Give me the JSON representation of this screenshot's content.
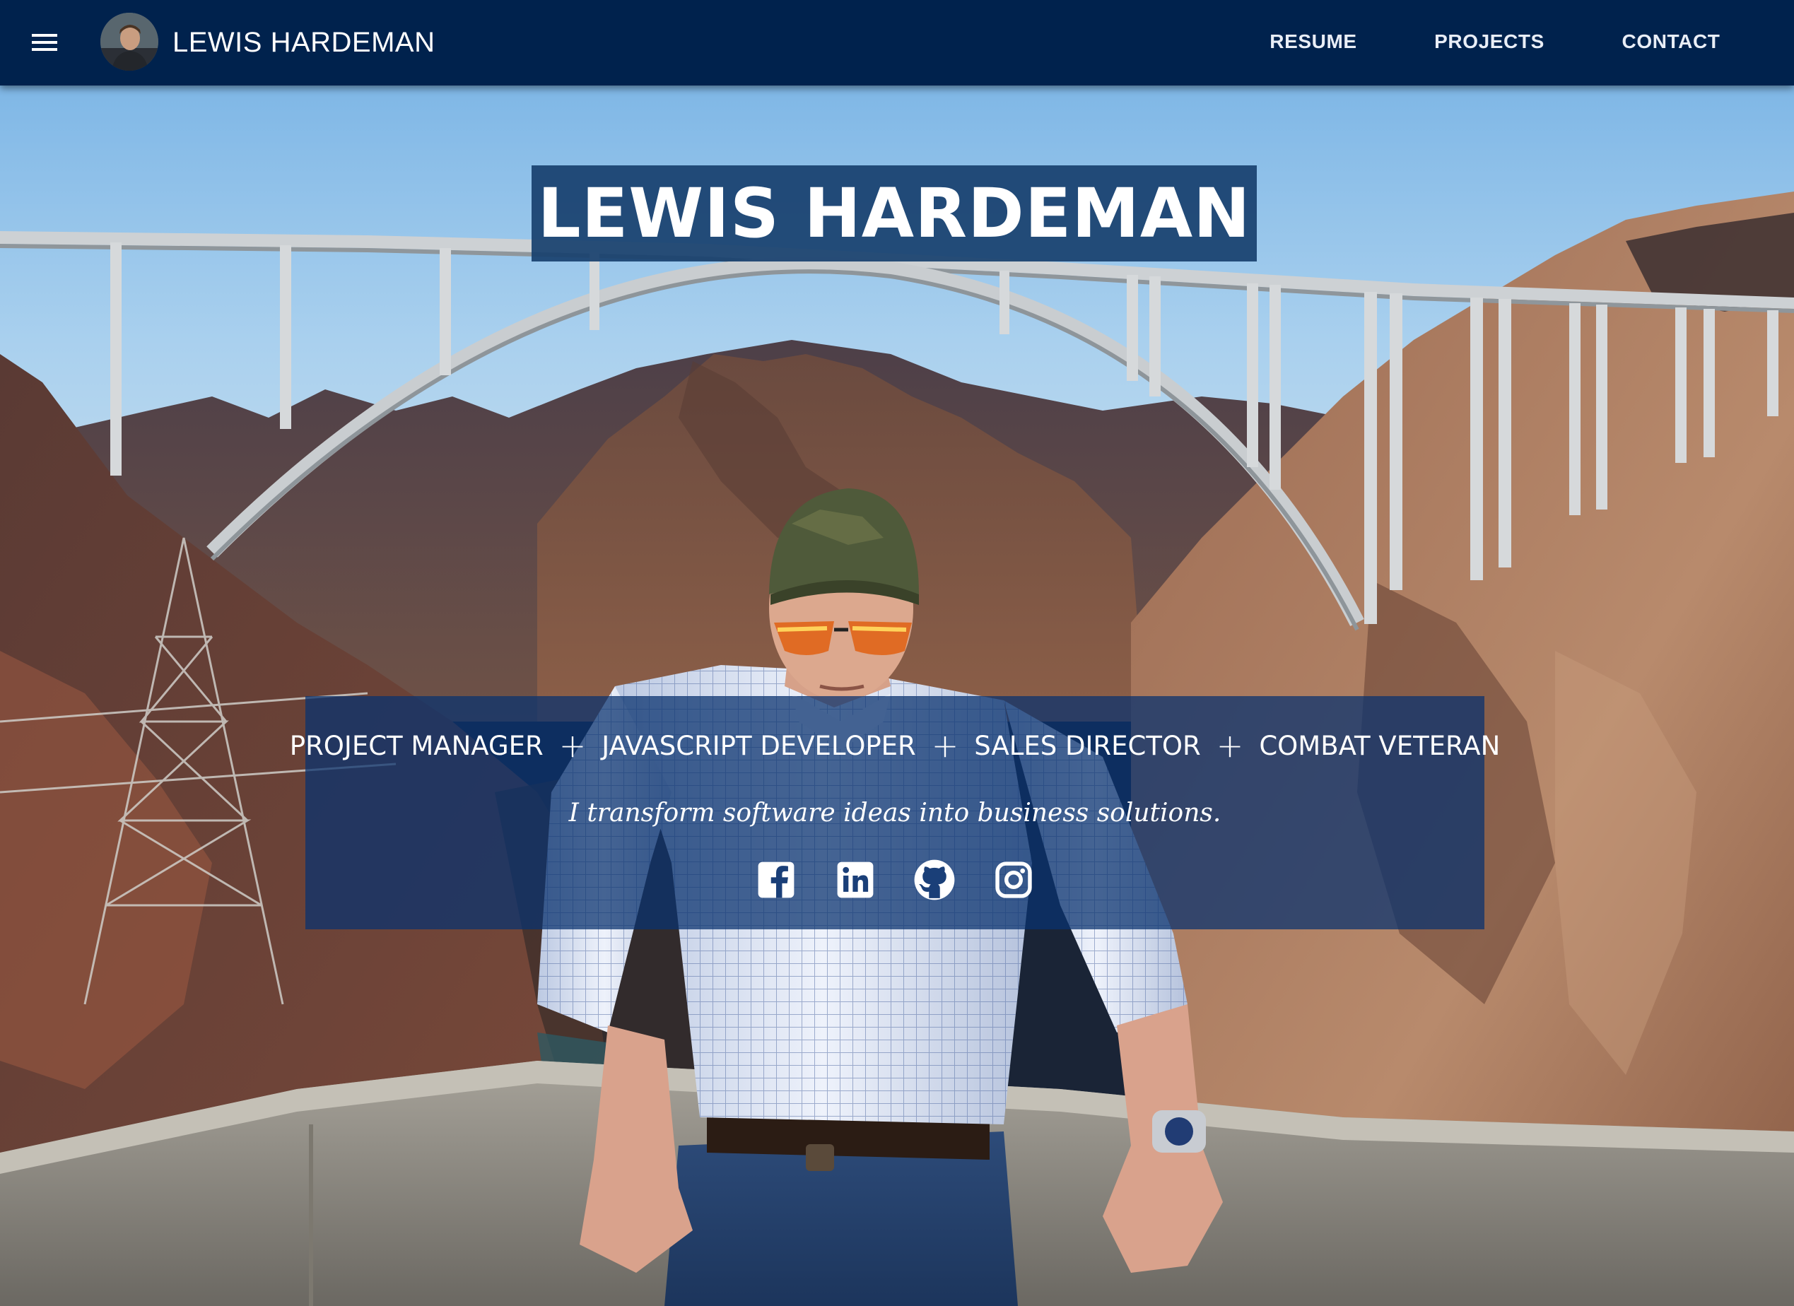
{
  "appbar": {
    "title": "LEWIS HARDEMAN",
    "menu_icon": "hamburger-menu-icon",
    "avatar": "profile-avatar",
    "nav": [
      {
        "label": "RESUME"
      },
      {
        "label": "PROJECTS"
      },
      {
        "label": "CONTACT"
      }
    ]
  },
  "hero": {
    "name": "LEWIS HARDEMAN",
    "roles": [
      "PROJECT MANAGER",
      "JAVASCRIPT DEVELOPER",
      "SALES DIRECTOR",
      "COMBAT VETERAN"
    ],
    "separator": "+",
    "tagline": "I transform software ideas into business solutions.",
    "social": [
      {
        "icon": "facebook-icon"
      },
      {
        "icon": "linkedin-icon"
      },
      {
        "icon": "github-icon"
      },
      {
        "icon": "instagram-icon"
      }
    ]
  },
  "colors": {
    "appbar_bg": "#00224d",
    "name_banner_bg": "#18406e",
    "panel_bg": "#0a326e",
    "text": "#ffffff"
  }
}
